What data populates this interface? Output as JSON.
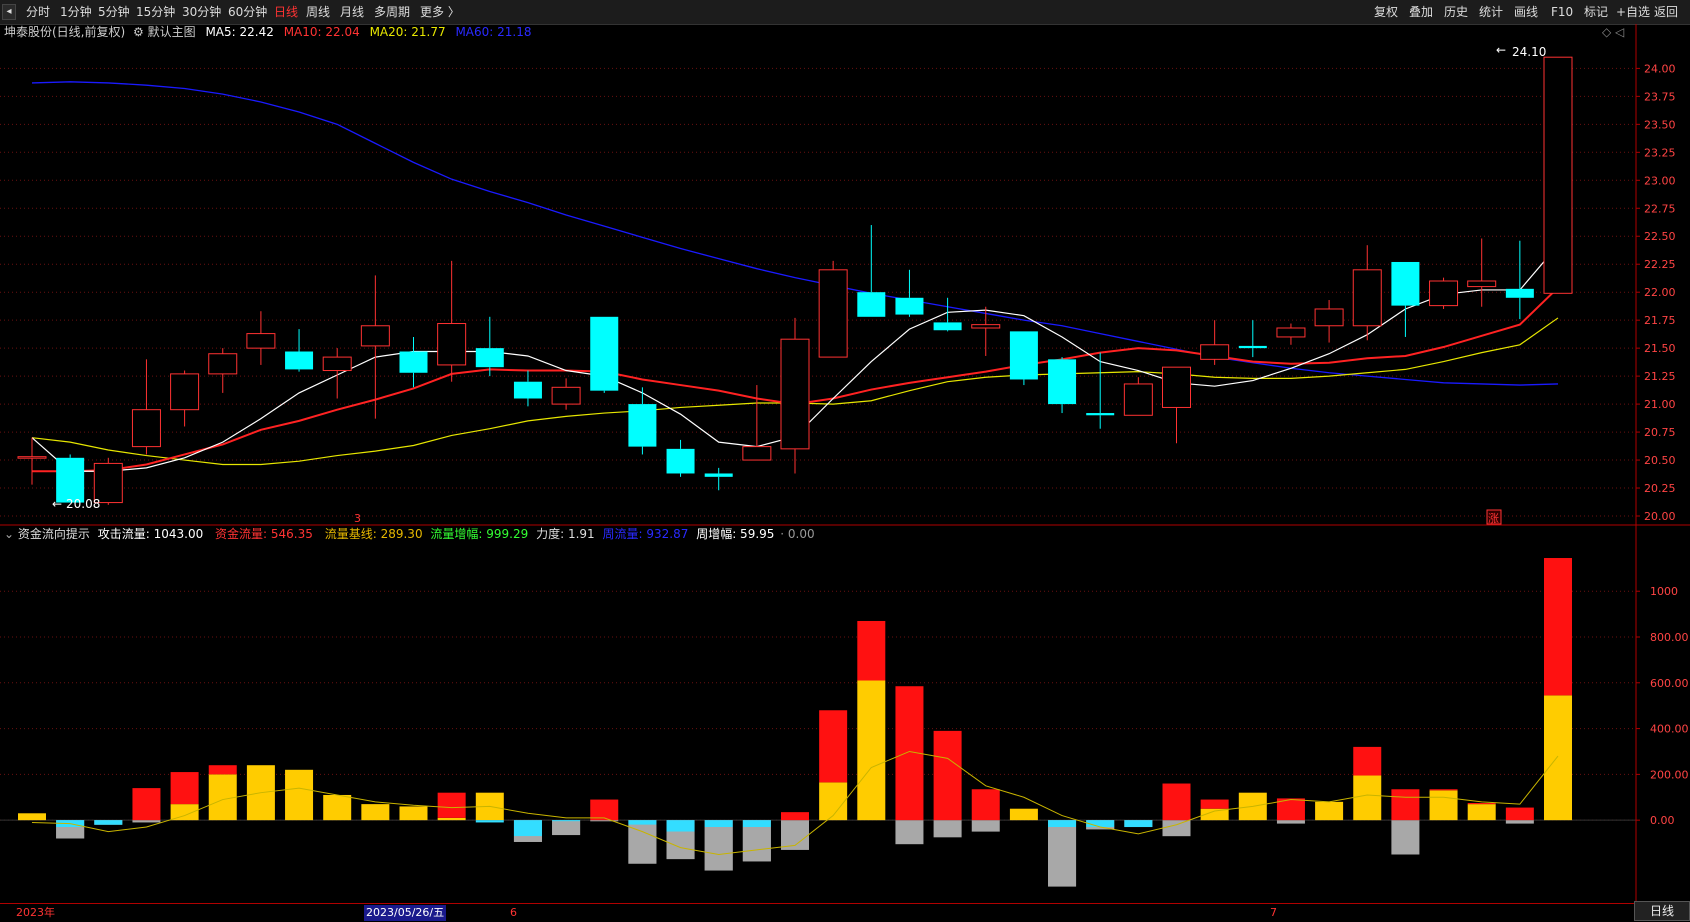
{
  "toolbar": {
    "back_glyph": "◂",
    "periods": [
      "分时",
      "1分钟",
      "5分钟",
      "15分钟",
      "30分钟",
      "60分钟",
      "日线",
      "周线",
      "月线",
      "多周期",
      "更多 〉"
    ],
    "active_period": "日线",
    "right_buttons": [
      "复权",
      "叠加",
      "历史",
      "统计",
      "画线",
      "F10",
      "标记",
      "+自选",
      "返回"
    ]
  },
  "stock_info": {
    "title": "坤泰股份(日线,前复权)",
    "indicator_name": "默认主图",
    "ma5": "MA5: 22.42",
    "ma10": "MA10: 22.04",
    "ma20": "MA20: 21.77",
    "ma60": "MA60: 21.18",
    "corner_glyph": "◇ ◁"
  },
  "colors": {
    "up": "#ff3232",
    "down": "#00ffff",
    "ma5": "#ffffff",
    "ma10": "#ff2222",
    "ma20": "#e6e600",
    "ma60": "#1a1aff",
    "grid": "#6a1010",
    "axis": "#b00000"
  },
  "price_axis": {
    "ticks": [
      "24.00",
      "23.75",
      "23.50",
      "23.25",
      "23.00",
      "22.75",
      "22.50",
      "22.25",
      "22.00",
      "21.75",
      "21.50",
      "21.25",
      "21.00",
      "20.75",
      "20.50",
      "20.25",
      "20.00"
    ]
  },
  "annotations": {
    "high_label": "24.10",
    "low_label": "20.08",
    "limit_up_badge": "涨",
    "marker_3": "3"
  },
  "money_flow": {
    "title": "资金流向提示",
    "attack": "攻击流量: 1043.00",
    "fund": "资金流量: 546.35",
    "base": "流量基线: 289.30",
    "increase": "流量增幅: 999.29",
    "force": "力度: 1.91",
    "weekly_flow": "周流量: 932.87",
    "weekly_increase": "周增幅: 59.95",
    "zero": "· 0.00",
    "axis_ticks": [
      "1000",
      "800.00",
      "600.00",
      "400.00",
      "200.00",
      "0.00"
    ]
  },
  "date_axis": {
    "year": "2023年",
    "cursor_date": "2023/05/26/五",
    "month6": "6",
    "month7": "7"
  },
  "footer_tab": "日线",
  "chart_data": [
    {
      "type": "candlestick",
      "title": "坤泰股份(日线,前复权)",
      "ylim": [
        20.0,
        24.2
      ],
      "candles": [
        {
          "o": 20.53,
          "h": 20.7,
          "l": 20.28,
          "c": 20.53
        },
        {
          "o": 20.52,
          "h": 20.55,
          "l": 20.12,
          "c": 20.12
        },
        {
          "o": 20.12,
          "h": 20.52,
          "l": 20.1,
          "c": 20.47
        },
        {
          "o": 20.62,
          "h": 21.4,
          "l": 20.55,
          "c": 20.95
        },
        {
          "o": 20.95,
          "h": 21.3,
          "l": 20.8,
          "c": 21.27
        },
        {
          "o": 21.27,
          "h": 21.5,
          "l": 21.1,
          "c": 21.45
        },
        {
          "o": 21.5,
          "h": 21.83,
          "l": 21.35,
          "c": 21.63
        },
        {
          "o": 21.47,
          "h": 21.67,
          "l": 21.29,
          "c": 21.31
        },
        {
          "o": 21.3,
          "h": 21.5,
          "l": 21.05,
          "c": 21.42
        },
        {
          "o": 21.52,
          "h": 22.15,
          "l": 20.87,
          "c": 21.7
        },
        {
          "o": 21.47,
          "h": 21.6,
          "l": 21.15,
          "c": 21.28
        },
        {
          "o": 21.35,
          "h": 22.28,
          "l": 21.2,
          "c": 21.72
        },
        {
          "o": 21.5,
          "h": 21.78,
          "l": 21.25,
          "c": 21.33
        },
        {
          "o": 21.2,
          "h": 21.3,
          "l": 20.98,
          "c": 21.05
        },
        {
          "o": 21.0,
          "h": 21.23,
          "l": 20.95,
          "c": 21.15
        },
        {
          "o": 21.78,
          "h": 21.78,
          "l": 21.1,
          "c": 21.12
        },
        {
          "o": 21.0,
          "h": 21.15,
          "l": 20.55,
          "c": 20.62
        },
        {
          "o": 20.6,
          "h": 20.68,
          "l": 20.35,
          "c": 20.38
        },
        {
          "o": 20.38,
          "h": 20.43,
          "l": 20.23,
          "c": 20.35
        },
        {
          "o": 20.5,
          "h": 21.17,
          "l": 20.5,
          "c": 20.62
        },
        {
          "o": 20.6,
          "h": 21.77,
          "l": 20.38,
          "c": 21.58
        },
        {
          "o": 21.42,
          "h": 22.28,
          "l": 21.42,
          "c": 22.2
        },
        {
          "o": 22.0,
          "h": 22.6,
          "l": 21.78,
          "c": 21.78
        },
        {
          "o": 21.95,
          "h": 22.2,
          "l": 21.78,
          "c": 21.8
        },
        {
          "o": 21.73,
          "h": 21.95,
          "l": 21.65,
          "c": 21.66
        },
        {
          "o": 21.68,
          "h": 21.87,
          "l": 21.43,
          "c": 21.71
        },
        {
          "o": 21.65,
          "h": 21.65,
          "l": 21.17,
          "c": 21.22
        },
        {
          "o": 21.4,
          "h": 21.42,
          "l": 20.92,
          "c": 21.0
        },
        {
          "o": 20.92,
          "h": 21.46,
          "l": 20.78,
          "c": 20.9
        },
        {
          "o": 20.9,
          "h": 21.24,
          "l": 20.9,
          "c": 21.18
        },
        {
          "o": 20.97,
          "h": 21.29,
          "l": 20.65,
          "c": 21.33
        },
        {
          "o": 21.4,
          "h": 21.75,
          "l": 21.35,
          "c": 21.53
        },
        {
          "o": 21.52,
          "h": 21.75,
          "l": 21.42,
          "c": 21.5
        },
        {
          "o": 21.6,
          "h": 21.72,
          "l": 21.53,
          "c": 21.68
        },
        {
          "o": 21.7,
          "h": 21.93,
          "l": 21.55,
          "c": 21.85
        },
        {
          "o": 21.7,
          "h": 22.42,
          "l": 21.57,
          "c": 22.2
        },
        {
          "o": 22.27,
          "h": 22.27,
          "l": 21.6,
          "c": 21.88
        },
        {
          "o": 21.88,
          "h": 22.13,
          "l": 21.85,
          "c": 22.1
        },
        {
          "o": 22.05,
          "h": 22.48,
          "l": 21.87,
          "c": 22.1
        },
        {
          "o": 22.03,
          "h": 22.46,
          "l": 21.76,
          "c": 21.95
        },
        {
          "o": 21.99,
          "h": 24.1,
          "l": 21.99,
          "c": 24.1
        }
      ],
      "ma5": [
        20.7,
        20.4,
        20.4,
        20.43,
        20.52,
        20.66,
        20.87,
        21.1,
        21.26,
        21.42,
        21.47,
        21.47,
        21.47,
        21.43,
        21.3,
        21.25,
        21.1,
        20.91,
        20.66,
        20.62,
        20.71,
        21.05,
        21.38,
        21.67,
        21.82,
        21.84,
        21.79,
        21.6,
        21.38,
        21.3,
        21.19,
        21.16,
        21.21,
        21.32,
        21.45,
        21.62,
        21.85,
        21.98,
        22.02,
        22.02,
        22.42
      ],
      "ma10": [
        20.4,
        20.4,
        20.41,
        20.46,
        20.55,
        20.64,
        20.77,
        20.85,
        20.95,
        21.04,
        21.14,
        21.27,
        21.31,
        21.3,
        21.3,
        21.29,
        21.22,
        21.17,
        21.12,
        21.05,
        21.0,
        21.05,
        21.13,
        21.19,
        21.24,
        21.29,
        21.35,
        21.4,
        21.46,
        21.5,
        21.48,
        21.43,
        21.38,
        21.36,
        21.37,
        21.41,
        21.43,
        21.51,
        21.61,
        21.71,
        22.04
      ],
      "ma20": [
        20.7,
        20.66,
        20.59,
        20.54,
        20.5,
        20.46,
        20.46,
        20.49,
        20.54,
        20.58,
        20.63,
        20.72,
        20.78,
        20.85,
        20.89,
        20.92,
        20.94,
        20.97,
        20.99,
        21.01,
        21.01,
        21.0,
        21.03,
        21.12,
        21.2,
        21.24,
        21.26,
        21.27,
        21.28,
        21.29,
        21.27,
        21.24,
        21.23,
        21.23,
        21.25,
        21.28,
        21.31,
        21.38,
        21.46,
        21.53,
        21.77
      ],
      "ma60": [
        23.87,
        23.88,
        23.87,
        23.85,
        23.82,
        23.77,
        23.7,
        23.61,
        23.5,
        23.33,
        23.16,
        23.01,
        22.9,
        22.8,
        22.69,
        22.59,
        22.49,
        22.39,
        22.3,
        22.21,
        22.13,
        22.06,
        21.99,
        21.93,
        21.87,
        21.81,
        21.75,
        21.7,
        21.63,
        21.56,
        21.49,
        21.42,
        21.37,
        21.32,
        21.28,
        21.25,
        21.22,
        21.19,
        21.18,
        21.17,
        21.18
      ]
    },
    {
      "type": "bar",
      "title": "资金流向提示",
      "ylim": [
        -340,
        1180
      ],
      "attack": [
        30,
        -30,
        -20,
        140,
        210,
        240,
        220,
        110,
        70,
        60,
        10,
        120,
        -10,
        -70,
        -5,
        90,
        -20,
        -50,
        -30,
        -30,
        35,
        480,
        870,
        585,
        390,
        135,
        50,
        -30,
        -30,
        -30,
        160,
        90,
        120,
        95,
        80,
        320,
        135,
        135,
        75,
        55,
        1145
      ],
      "base": [
        30,
        -80,
        -20,
        -10,
        70,
        200,
        240,
        220,
        110,
        70,
        60,
        10,
        120,
        -95,
        -65,
        -5,
        -190,
        -170,
        -220,
        -180,
        -130,
        165,
        610,
        -105,
        -75,
        -50,
        50,
        -290,
        -40,
        -30,
        -70,
        50,
        120,
        -15,
        80,
        195,
        -150,
        130,
        70,
        -15,
        545
      ],
      "line": [
        -10,
        -15,
        -50,
        -30,
        20,
        90,
        120,
        140,
        110,
        80,
        65,
        55,
        60,
        30,
        10,
        10,
        -50,
        -120,
        -150,
        -130,
        -110,
        20,
        230,
        300,
        270,
        150,
        100,
        20,
        -30,
        -60,
        -20,
        40,
        60,
        90,
        80,
        110,
        100,
        100,
        80,
        70,
        280
      ]
    }
  ]
}
